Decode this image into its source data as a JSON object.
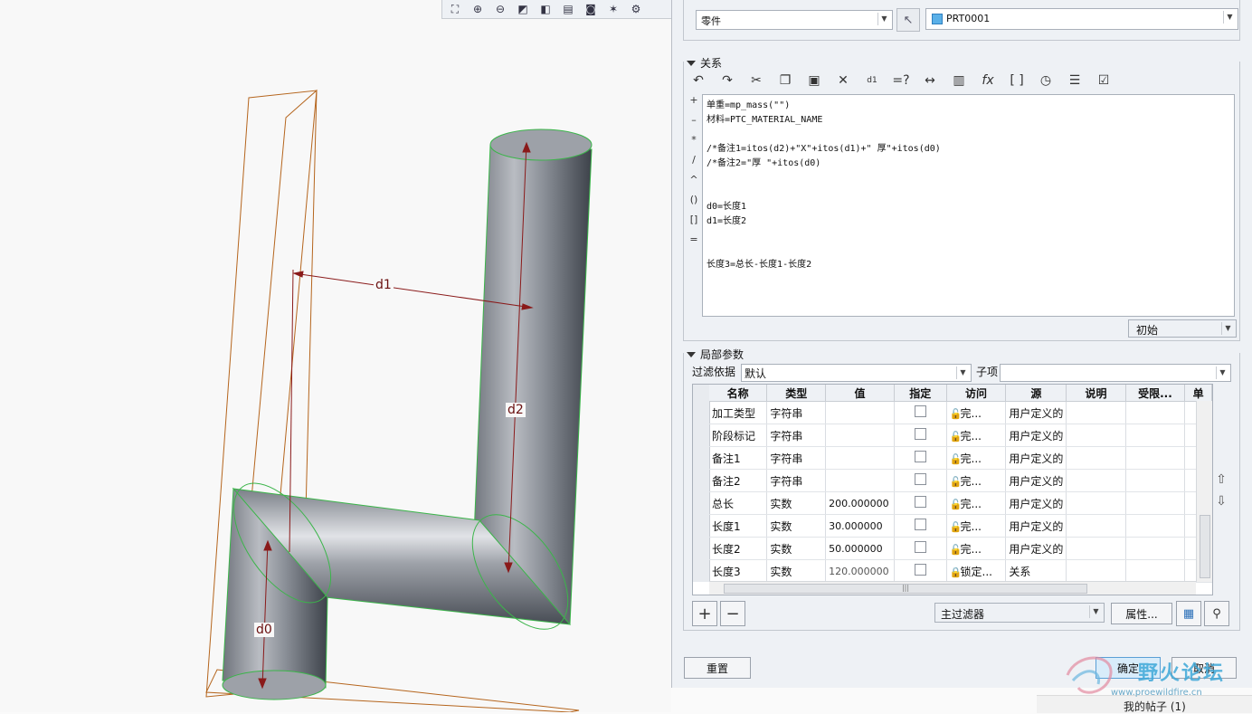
{
  "viewport": {
    "toolbar_icons": [
      "zoom-fit-icon",
      "zoom-in-icon",
      "zoom-out-icon",
      "repaint-icon",
      "view-orientation-icon",
      "saved-views-icon",
      "camera-icon",
      "datum-display-icon",
      "settings-icon"
    ],
    "dimensions": {
      "d0": "d0",
      "d1": "d1",
      "d2": "d2"
    }
  },
  "dialog": {
    "type_select": "零件",
    "part_name": "PRT0001",
    "relations_header": "关系",
    "relations_toolbar_icons": [
      "undo-icon",
      "redo-icon",
      "cut-icon",
      "copy-icon",
      "paste-icon",
      "delete-icon",
      "switch-dims-icon",
      "evaluate-icon",
      "measure-icon",
      "parameters-icon",
      "function-icon",
      "brackets-icon",
      "verify-icon",
      "sort-icon",
      "insert-icon"
    ],
    "operators": [
      "+",
      "–",
      "*",
      "/",
      "^",
      "()",
      "[]",
      "="
    ],
    "relations_lines": [
      "单重=mp_mass(\"\")",
      "材料=PTC_MATERIAL_NAME",
      "",
      "/*备注1=itos(d2)+\"X\"+itos(d1)+\" 厚\"+itos(d0)",
      "/*备注2=\"厚 \"+itos(d0)",
      "",
      "",
      "d0=长度1",
      "d1=长度2",
      "",
      "",
      "长度3=总长-长度1-长度2"
    ],
    "init_select": "初始",
    "local_params_header": "局部参数",
    "filter_label": "过滤依据",
    "filter_value": "默认",
    "child_label": "子项",
    "table": {
      "headers": [
        "名称",
        "类型",
        "值",
        "指定",
        "访问",
        "源",
        "说明",
        "受限...",
        "单"
      ],
      "rows": [
        {
          "name": "加工类型",
          "type": "字符串",
          "value": "",
          "access": "完...",
          "source": "用户定义的"
        },
        {
          "name": "阶段标记",
          "type": "字符串",
          "value": "",
          "access": "完...",
          "source": "用户定义的"
        },
        {
          "name": "备注1",
          "type": "字符串",
          "value": "",
          "access": "完...",
          "source": "用户定义的"
        },
        {
          "name": "备注2",
          "type": "字符串",
          "value": "",
          "access": "完...",
          "source": "用户定义的"
        },
        {
          "name": "总长",
          "type": "实数",
          "value": "200.000000",
          "access": "完...",
          "source": "用户定义的"
        },
        {
          "name": "长度1",
          "type": "实数",
          "value": "30.000000",
          "access": "完...",
          "source": "用户定义的"
        },
        {
          "name": "长度2",
          "type": "实数",
          "value": "50.000000",
          "access": "完...",
          "source": "用户定义的"
        },
        {
          "name": "长度3",
          "type": "实数",
          "value": "120.000000",
          "access": "锁定...",
          "source": "关系"
        }
      ]
    },
    "main_filter": "主过滤器",
    "properties_button": "属性...",
    "reset_button": "重置",
    "ok_button": "确定",
    "cancel_button": "取消"
  },
  "watermark": {
    "text": "野火论坛",
    "url": "www.proewildfire.cn"
  },
  "footer_link": "我的帖子 (1)"
}
